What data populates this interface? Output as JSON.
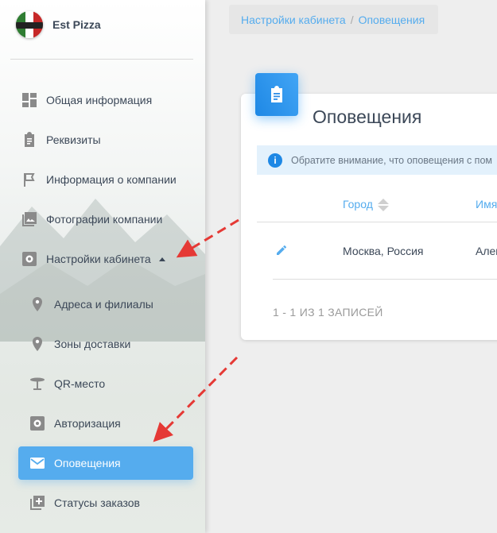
{
  "brand": {
    "name": "Est Pizza"
  },
  "sidebar": {
    "items": [
      {
        "label": "Общая информация",
        "icon": "dashboard-icon"
      },
      {
        "label": "Реквизиты",
        "icon": "clipboard-icon"
      },
      {
        "label": "Информация о компании",
        "icon": "flag-icon"
      },
      {
        "label": "Фотографии компании",
        "icon": "photo-icon"
      },
      {
        "label": "Настройки кабинета",
        "icon": "settings-icon",
        "expanded": true
      },
      {
        "label": "Адреса и филиалы",
        "icon": "location-pin-icon"
      },
      {
        "label": "Зоны доставки",
        "icon": "location-pin-icon"
      },
      {
        "label": "QR-место",
        "icon": "table-icon"
      },
      {
        "label": "Авторизация",
        "icon": "settings-icon"
      },
      {
        "label": "Оповещения",
        "icon": "mail-icon",
        "active": true
      },
      {
        "label": "Статусы заказов",
        "icon": "add-box-icon"
      }
    ]
  },
  "breadcrumb": {
    "parent": "Настройки кабинета",
    "separator": "/",
    "current": "Оповещения"
  },
  "card": {
    "title": "Оповещения",
    "icon": "clipboard-icon",
    "alert": "Обратите внимание, что оповещения с пом",
    "columns": [
      "Город",
      "Имя"
    ],
    "rows": [
      {
        "city": "Москва, Россия",
        "name": "Алек"
      }
    ],
    "footer": "1 - 1 ИЗ 1 ЗАПИСЕЙ"
  },
  "colors": {
    "accent": "#55acee",
    "annotation_arrow": "#e53935"
  }
}
